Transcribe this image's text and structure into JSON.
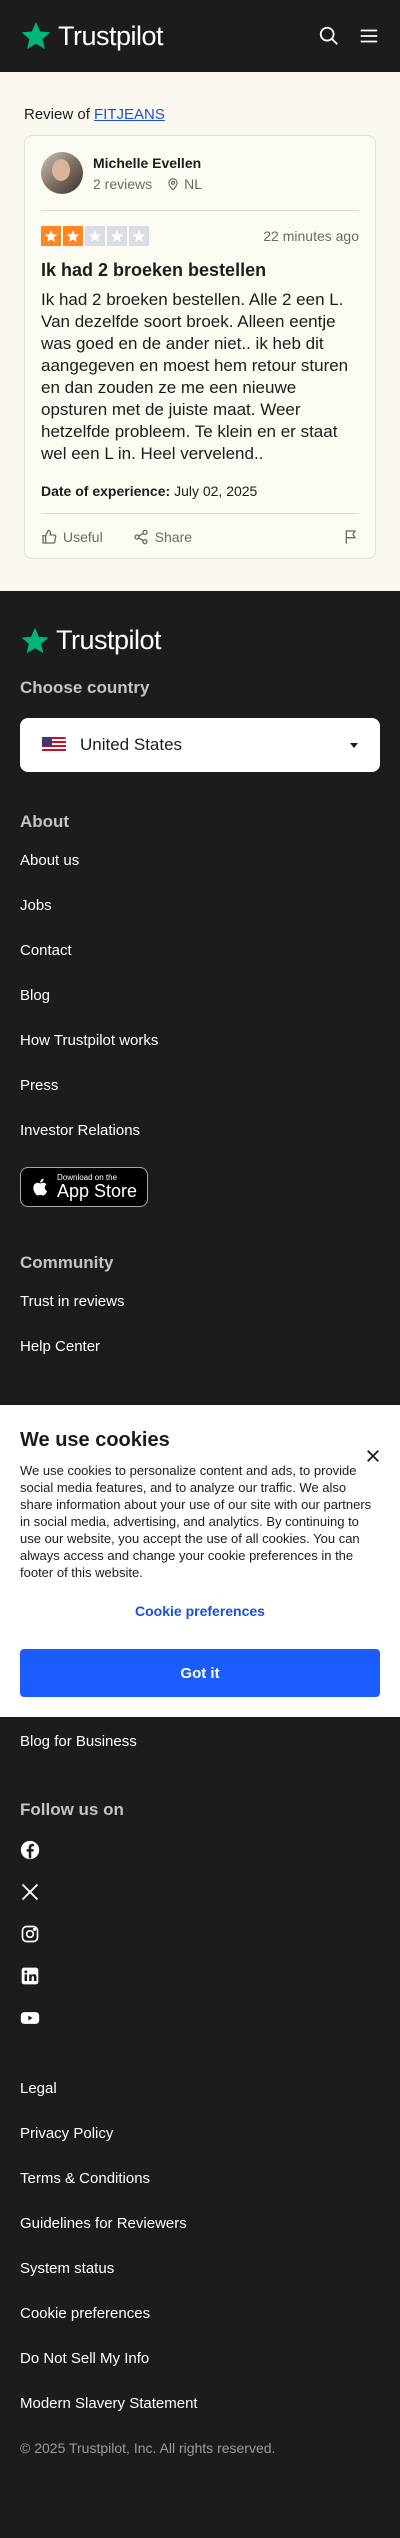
{
  "header": {
    "logo_text": "Trustpilot"
  },
  "review_of": {
    "prefix": "Review of",
    "company": "FITJEANS"
  },
  "review": {
    "user_name": "Michelle Evellen",
    "reviews_count": "2 reviews",
    "location": "NL",
    "rating": 2,
    "max_rating": 5,
    "time_ago": "22 minutes ago",
    "title": "Ik had 2 broeken bestellen",
    "body": "Ik had 2 broeken bestellen. Alle 2 een L. Van dezelfde soort broek. Alleen eentje was goed en de ander niet.. ik heb dit aangegeven en moest hem retour sturen en dan zouden ze me een nieuwe opsturen met de juiste maat. Weer hetzelfde probleem. Te klein en er staat wel een L in. Heel vervelend..",
    "doe_label": "Date of experience:",
    "doe_value": "July 02, 2025",
    "useful_label": "Useful",
    "share_label": "Share"
  },
  "footer": {
    "logo_text": "Trustpilot",
    "choose_country": "Choose country",
    "country": "United States",
    "about_heading": "About",
    "about_links": [
      "About us",
      "Jobs",
      "Contact",
      "Blog",
      "How Trustpilot works",
      "Press",
      "Investor Relations"
    ],
    "appstore_small": "Download on the",
    "appstore_big": "App Store",
    "community_heading": "Community",
    "community_links": [
      "Trust in reviews",
      "Help Center"
    ],
    "business_link": "Blog for Business",
    "follow_heading": "Follow us on",
    "legal_links": [
      "Legal",
      "Privacy Policy",
      "Terms & Conditions",
      "Guidelines for Reviewers",
      "System status",
      "Cookie preferences",
      "Do Not Sell My Info",
      "Modern Slavery Statement"
    ],
    "copyright": "© 2025 Trustpilot, Inc. All rights reserved."
  },
  "cookie": {
    "title": "We use cookies",
    "text": "We use cookies to personalize content and ads, to provide social media features, and to analyze our traffic. We also share information about your use of our site with our partners in social media, advertising, and analytics. By continuing to use our website, you accept the use of all cookies. You can always access and change your cookie preferences in the footer of this website.",
    "preferences": "Cookie preferences",
    "accept": "Got it"
  },
  "colors": {
    "star_on": "#ff8622",
    "star_off": "#dcdce6",
    "accent": "#1b5cff",
    "brand_green": "#00b67a"
  }
}
